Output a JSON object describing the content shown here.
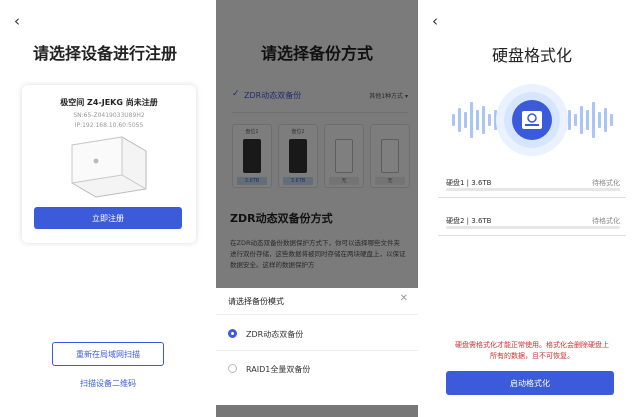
{
  "panel1": {
    "back_icon": "chevron-left-icon",
    "title": "请选择设备进行注册",
    "device": {
      "name": "极空间 Z4-JEKG 尚未注册",
      "sn": "SN:65-Z0419033U89H2",
      "ip": "IP:192.168.10.60:5055"
    },
    "register_label": "立即注册",
    "rescan_label": "重新在局域网扫描",
    "qr_label": "扫描设备二维码"
  },
  "panel2": {
    "title": "请选择备份方式",
    "selected_mode": "ZDR动态双备份",
    "other_modes_label": "其他1种方式",
    "disks": [
      {
        "label": "盘位1",
        "capacity": "3.6TB",
        "filled": true
      },
      {
        "label": "盘位2",
        "capacity": "3.6TB",
        "filled": true
      },
      {
        "label": "",
        "capacity": "无",
        "filled": false
      },
      {
        "label": "",
        "capacity": "无",
        "filled": false
      }
    ],
    "section_title": "ZDR动态双备份方式",
    "section_desc": "在ZDR动态双备份数据保护方式下，你可以选择哪些文件夹进行双份存储，这些数据将被同时存储在两块硬盘上，以保证数据安全。这样的数据保护方",
    "sheet": {
      "title": "请选择备份模式",
      "close_icon": "close-icon",
      "options": [
        {
          "label": "ZDR动态双备份",
          "selected": true
        },
        {
          "label": "RAID1全量双备份",
          "selected": false
        }
      ]
    }
  },
  "panel3": {
    "back_icon": "chevron-left-icon",
    "title": "硬盘格式化",
    "disks": [
      {
        "name": "硬盘1 | 3.6TB",
        "status": "待格式化"
      },
      {
        "name": "硬盘2 | 3.6TB",
        "status": "待格式化"
      }
    ],
    "warning_line1": "硬盘需格式化才能正常使用。格式化会删除硬盘上",
    "warning_line2": "所有的数据，且不可恢复。",
    "start_label": "启动格式化"
  },
  "colors": {
    "accent": "#3b5bdb",
    "warning": "#d32f2f",
    "disk_capacity_bg": "#c8dcf3",
    "disk_capacity_text": "#3b5bdb"
  }
}
